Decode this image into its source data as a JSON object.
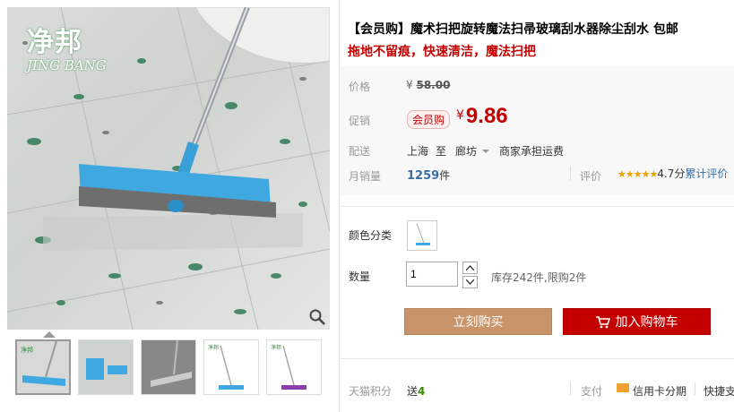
{
  "gallery": {
    "brand_cn": "净邦",
    "brand_en": "JING BANG"
  },
  "product": {
    "title": "【会员购】魔术扫把旋转魔法扫帚玻璃刮水器除尘刮水 包邮",
    "subtitle": "拖地不留痕，快速清洁，魔法扫把"
  },
  "price": {
    "label": "价格",
    "currency": "¥",
    "original": "58.00"
  },
  "promo": {
    "label": "促销",
    "badge": "会员购",
    "currency": "¥",
    "price": "9.86"
  },
  "shipping": {
    "label": "配送",
    "from": "上海",
    "to_word": "至",
    "to": "廊坊",
    "fee_note": "商家承担运费"
  },
  "sales": {
    "label": "月销量",
    "count": "1259",
    "unit": "件"
  },
  "rating": {
    "label": "评价",
    "stars": "★★★★★",
    "score": "4.7分",
    "link": "累计评价"
  },
  "options": {
    "color_label": "颜色分类",
    "qty_label": "数量",
    "qty_value": "1",
    "stock_note": "库存242件,限购2件"
  },
  "actions": {
    "buy_now": "立刻购买",
    "add_cart": "加入购物车"
  },
  "bottom": {
    "points_label": "天猫积分",
    "points_prefix": "送",
    "points_value": "4",
    "pay_label": "支付",
    "pay_method": "信用卡分期",
    "quick_label": "快捷支"
  },
  "colors": {
    "accent_red": "#c40000",
    "buy_button": "#c9946a",
    "sales_blue": "#3a6ea5",
    "star_gold": "#e8a100"
  }
}
